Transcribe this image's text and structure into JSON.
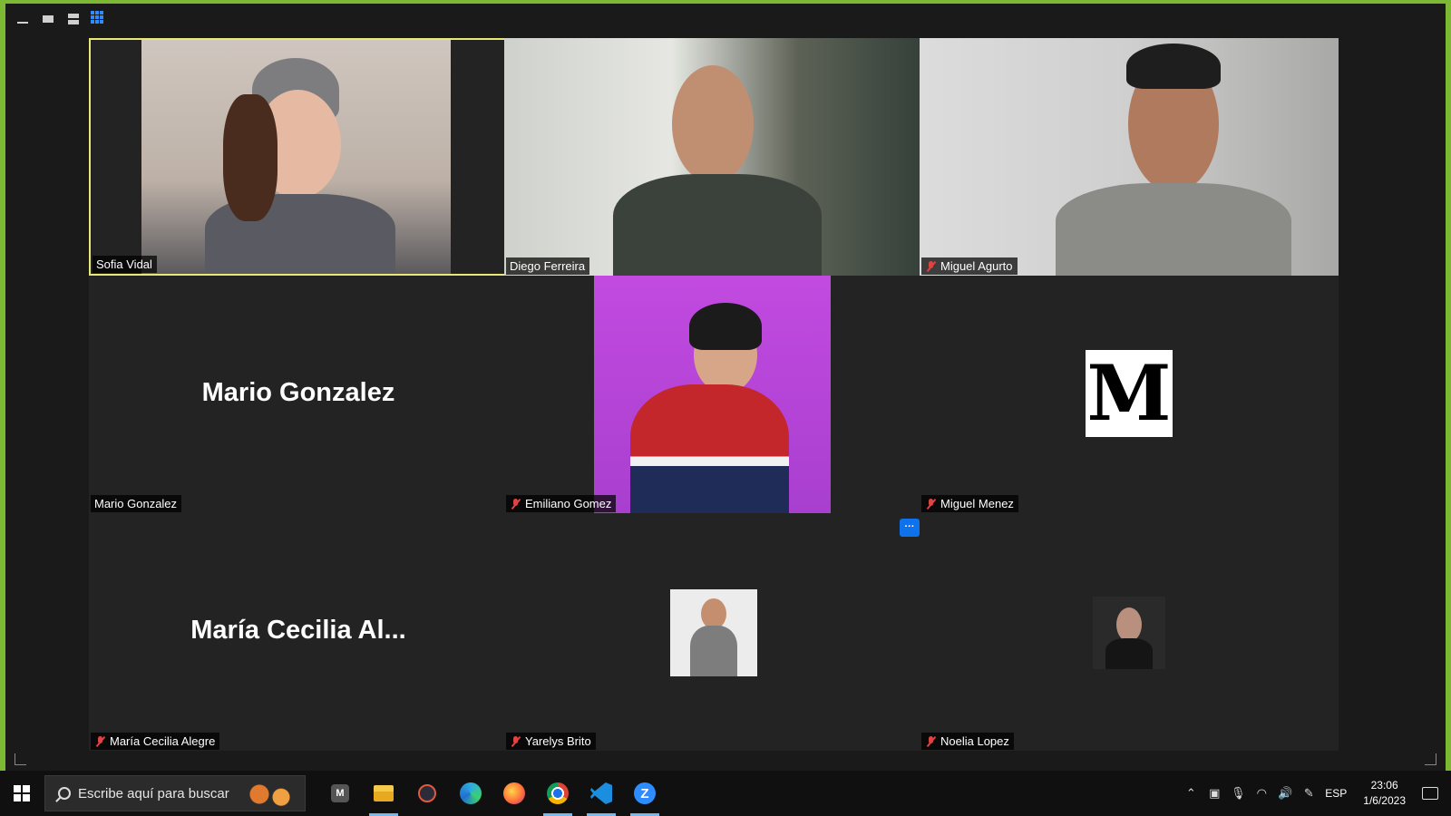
{
  "participants": [
    {
      "name": "Sofia Vidal",
      "muted": false,
      "active_speaker": true,
      "display": "video"
    },
    {
      "name": "Diego Ferreira",
      "muted": false,
      "display": "video"
    },
    {
      "name": "Miguel Agurto",
      "muted": true,
      "display": "video"
    },
    {
      "name": "Mario Gonzalez",
      "muted": false,
      "display": "name",
      "big_label": "Mario Gonzalez"
    },
    {
      "name": "Emiliano Gomez",
      "muted": true,
      "display": "video"
    },
    {
      "name": "Miguel Menez",
      "muted": true,
      "display": "avatar",
      "avatar_letter": "M"
    },
    {
      "name": "María Cecilia Alegre",
      "muted": true,
      "display": "name",
      "big_label": "María Cecilia Al..."
    },
    {
      "name": "Yarelys Brito",
      "muted": true,
      "display": "avatar"
    },
    {
      "name": "Noelia Lopez",
      "muted": true,
      "display": "avatar"
    }
  ],
  "more_button_label": "···",
  "taskbar": {
    "search_placeholder": "Escribe aquí para buscar",
    "apps": [
      "mail-app-icon",
      "file-explorer-icon",
      "obs-icon",
      "edge-icon",
      "firefox-icon",
      "chrome-icon",
      "vscode-icon",
      "zoom-icon"
    ],
    "language": "ESP",
    "time": "23:06",
    "date": "1/6/2023"
  },
  "colors": {
    "accent_border": "#7cb834",
    "active_speaker": "#e8e879",
    "zoom_blue": "#0e72ed",
    "muted_red": "#e04343"
  }
}
